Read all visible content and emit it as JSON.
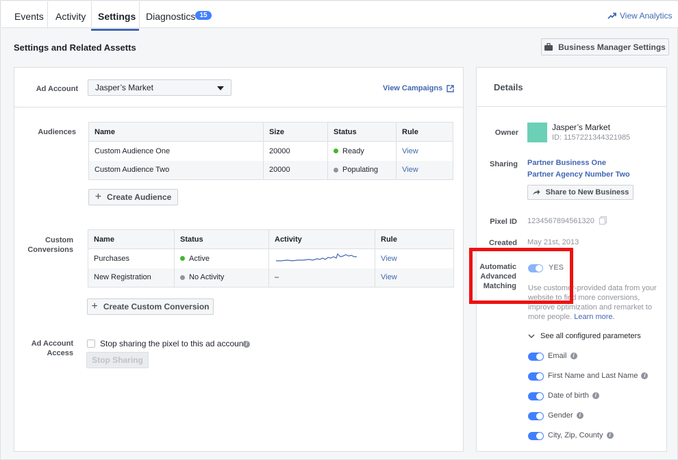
{
  "tabs": [
    {
      "label": "Events"
    },
    {
      "label": "Activity"
    },
    {
      "label": "Settings"
    },
    {
      "label": "Diagnostics",
      "badge": "15"
    }
  ],
  "header": {
    "view_analytics": "View Analytics",
    "title": "Settings and Related Assetts",
    "business_manager_button": "Business Manager Settings"
  },
  "ad_account": {
    "label": "Ad Account",
    "selected": "Jasper’s Market",
    "view_campaigns": "View Campaigns"
  },
  "audiences": {
    "label": "Audiences",
    "columns": [
      "Name",
      "Size",
      "Status",
      "Rule"
    ],
    "rows": [
      {
        "name": "Custom Audience One",
        "size": "20000",
        "status": "Ready",
        "status_color": "#42b72a",
        "rule": "View"
      },
      {
        "name": "Custom Audience Two",
        "size": "20000",
        "status": "Populating",
        "status_color": "#90949c",
        "rule": "View"
      }
    ],
    "create_button": "Create Audience"
  },
  "custom_conversions": {
    "label_line1": "Custom",
    "label_line2": "Conversions",
    "columns": [
      "Name",
      "Status",
      "Activity",
      "Rule"
    ],
    "rows": [
      {
        "name": "Purchases",
        "status": "Active",
        "status_color": "#42b72a",
        "activity": "",
        "rule": "View"
      },
      {
        "name": "New Registration",
        "status": "No Activity",
        "status_color": "#90949c",
        "activity": "–",
        "rule": "View"
      }
    ],
    "create_button": "Create Custom Conversion"
  },
  "ad_account_access": {
    "label_line1": "Ad Account",
    "label_line2": "Access",
    "checkbox_label": "Stop sharing the pixel to this ad account",
    "stop_button": "Stop Sharing"
  },
  "details": {
    "title": "Details",
    "owner_label": "Owner",
    "owner_name": "Jasper’s Market",
    "owner_id": "ID: 1157221344321985",
    "owner_color": "#6bd0b6",
    "sharing_label": "Sharing",
    "sharing_partners": [
      "Partner Business One",
      "Partner Agency Number Two"
    ],
    "share_button": "Share to New Business",
    "pixel_id_label": "Pixel ID",
    "pixel_id": "1234567894561320",
    "created_label": "Created",
    "created": "May 21st, 2013",
    "aam_label_line1": "Automatic",
    "aam_label_line2": "Advanced",
    "aam_label_line3": "Matching",
    "aam_value": "YES",
    "aam_desc_line1": "Use customer-provided data from your",
    "aam_desc_line2": "website to find more conversions,",
    "aam_desc_line3": "improve optimization and remarket to",
    "aam_desc_line4": "more people.",
    "learn_more": "Learn more.",
    "see_params": "See all configured parameters",
    "params": [
      "Email",
      "First Name and Last Name",
      "Date of birth",
      "Gender",
      "City, Zip, County"
    ]
  },
  "colors": {
    "accent": "#4267b2",
    "highlight": "#ee1111"
  }
}
